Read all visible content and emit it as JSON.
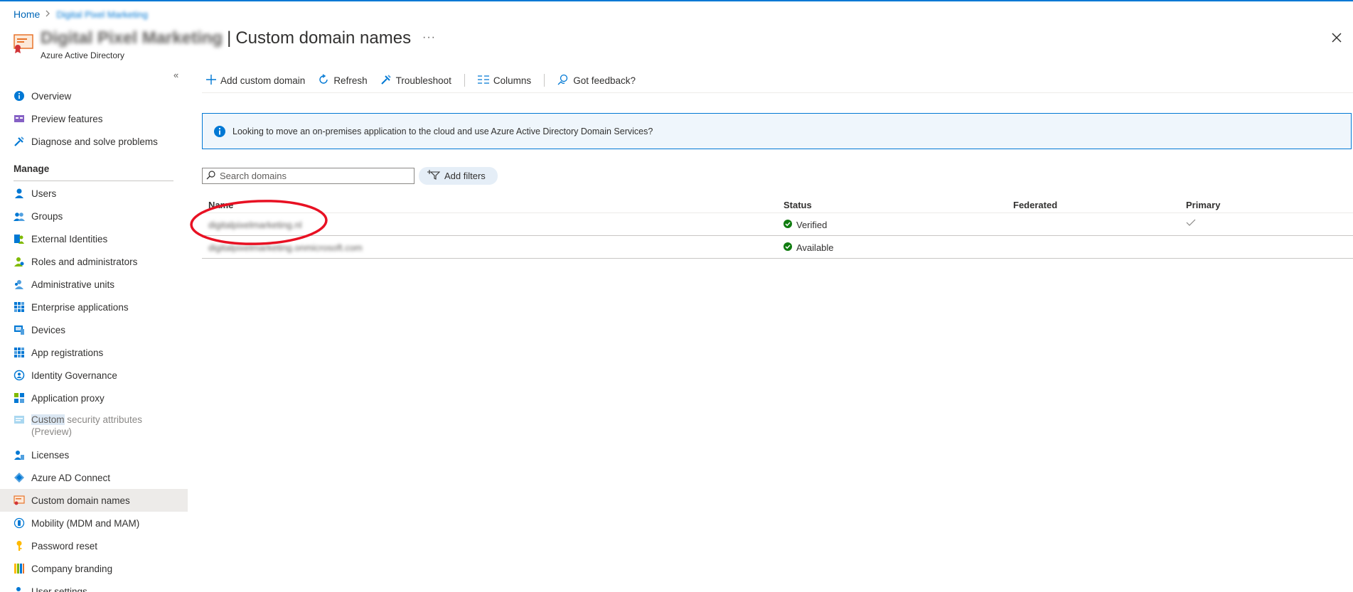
{
  "breadcrumb": {
    "home": "Home",
    "tenant": "Digital Pixel Marketing"
  },
  "header": {
    "tenant_name": "Digital Pixel Marketing",
    "separator": "|",
    "title": "Custom domain names",
    "more": "···",
    "subtitle": "Azure Active Directory"
  },
  "sidebar": {
    "collapse": "«",
    "top_items": [
      {
        "label": "Overview",
        "icon": "info-icon"
      },
      {
        "label": "Preview features",
        "icon": "preview-icon"
      },
      {
        "label": "Diagnose and solve problems",
        "icon": "wrench-icon"
      }
    ],
    "section": "Manage",
    "manage_items": [
      {
        "label": "Users",
        "icon": "user-icon"
      },
      {
        "label": "Groups",
        "icon": "groups-icon"
      },
      {
        "label": "External Identities",
        "icon": "external-identities-icon"
      },
      {
        "label": "Roles and administrators",
        "icon": "roles-icon"
      },
      {
        "label": "Administrative units",
        "icon": "admin-units-icon"
      },
      {
        "label": "Enterprise applications",
        "icon": "grid-icon"
      },
      {
        "label": "Devices",
        "icon": "device-icon"
      },
      {
        "label": "App registrations",
        "icon": "grid-icon"
      },
      {
        "label": "Identity Governance",
        "icon": "governance-icon"
      },
      {
        "label": "Application proxy",
        "icon": "proxy-icon"
      }
    ],
    "custom_attrs": {
      "highlight": "Custom",
      "rest": " security attributes",
      "line2": "(Preview)"
    },
    "lower_items": [
      {
        "label": "Licenses",
        "icon": "license-icon"
      },
      {
        "label": "Azure AD Connect",
        "icon": "connect-icon"
      },
      {
        "label": "Custom domain names",
        "icon": "domain-icon",
        "selected": true
      },
      {
        "label": "Mobility (MDM and MAM)",
        "icon": "mobility-icon"
      },
      {
        "label": "Password reset",
        "icon": "key-icon"
      },
      {
        "label": "Company branding",
        "icon": "branding-icon"
      },
      {
        "label": "User settings",
        "icon": "settings-icon"
      }
    ]
  },
  "toolbar": {
    "add": "Add custom domain",
    "refresh": "Refresh",
    "troubleshoot": "Troubleshoot",
    "columns": "Columns",
    "feedback": "Got feedback?"
  },
  "banner": {
    "text": "Looking to move an on-premises application to the cloud and use Azure Active Directory Domain Services?"
  },
  "search": {
    "placeholder": "Search domains",
    "value": ""
  },
  "filters": {
    "label": "Add filters"
  },
  "table": {
    "columns": [
      "Name",
      "Status",
      "Federated",
      "Primary"
    ],
    "rows": [
      {
        "name": "digitalpixelmarketing.nl",
        "status": "Verified",
        "federated": "",
        "primary": true
      },
      {
        "name": "digitalpixelmarketing.onmicrosoft.com",
        "status": "Available",
        "federated": "",
        "primary": false
      }
    ]
  },
  "colors": {
    "accent": "#0078d4",
    "success": "#107c10",
    "annotation": "#e81123",
    "selected_bg": "#edebe9"
  }
}
